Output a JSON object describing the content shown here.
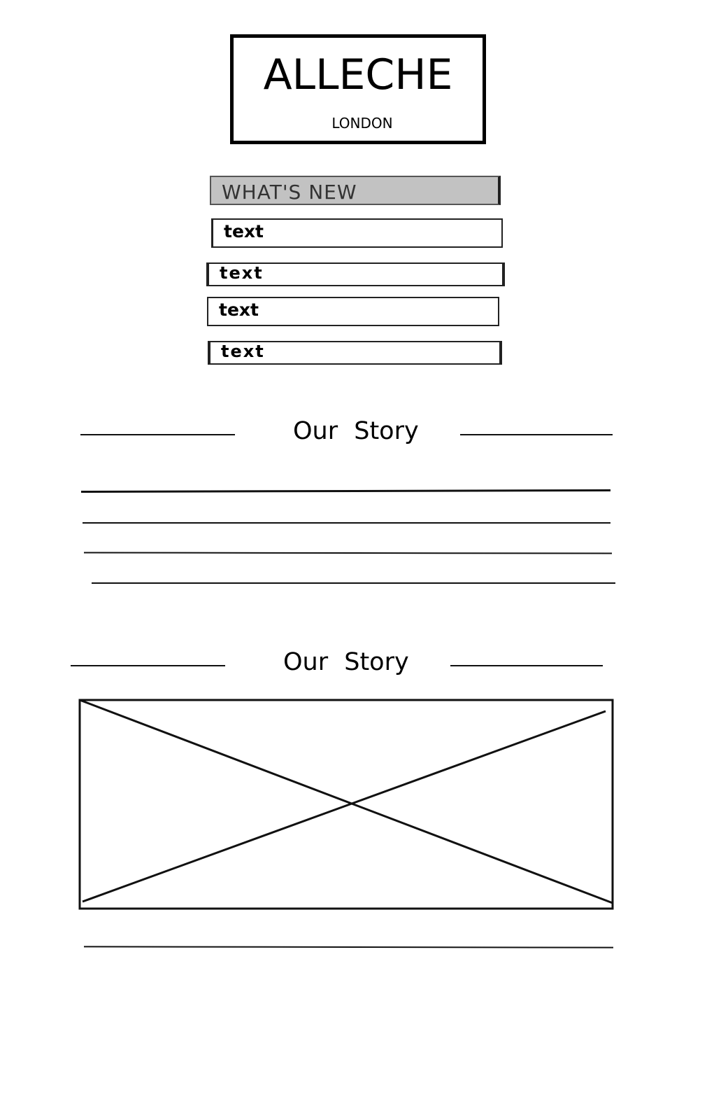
{
  "logo": {
    "title": "ALLECHE",
    "subtitle": "LONDON"
  },
  "menu": {
    "items": [
      {
        "label": "WHAT'S NEW",
        "selected": true
      },
      {
        "label": "text",
        "selected": false
      },
      {
        "label": "text",
        "selected": false
      },
      {
        "label": "text",
        "selected": false
      },
      {
        "label": "text",
        "selected": false
      }
    ]
  },
  "sections": [
    {
      "title": "Our Story"
    },
    {
      "title": "Our Story"
    }
  ],
  "colors": {
    "background": "#ffffff",
    "ink": "#000000",
    "highlight": "#c2c2c2"
  },
  "icons": {
    "image_placeholder": "crossed-box-image-icon"
  }
}
